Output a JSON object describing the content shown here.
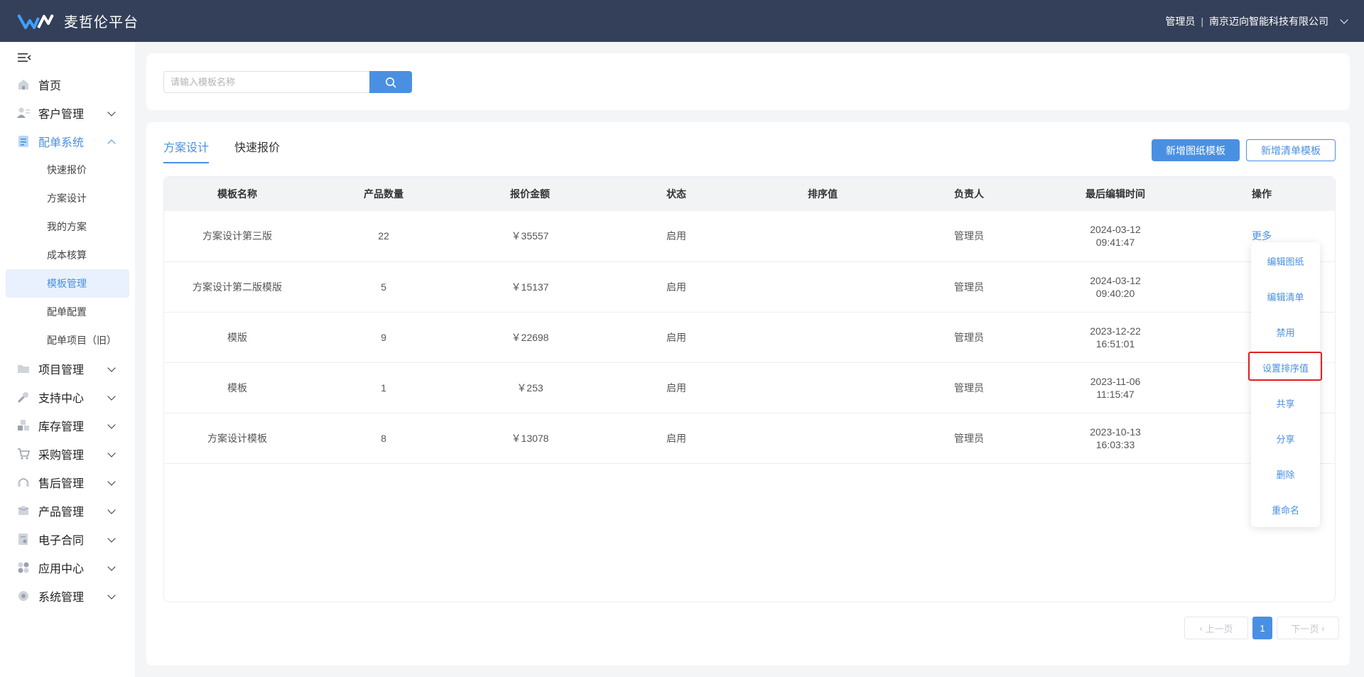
{
  "app": {
    "title": "麦哲伦平台"
  },
  "header": {
    "role": "管理员",
    "separator": "|",
    "company": "南京迈向智能科技有限公司"
  },
  "sidebar": {
    "items": [
      {
        "label": "首页",
        "icon": "home-icon"
      },
      {
        "label": "客户管理",
        "icon": "customer-icon"
      },
      {
        "label": "配单系统",
        "icon": "order-icon",
        "children": [
          "快速报价",
          "方案设计",
          "我的方案",
          "成本核算",
          "模板管理",
          "配单配置",
          "配单项目（旧）"
        ]
      },
      {
        "label": "项目管理",
        "icon": "folder-icon"
      },
      {
        "label": "支持中心",
        "icon": "wrench-icon"
      },
      {
        "label": "库存管理",
        "icon": "inventory-icon"
      },
      {
        "label": "采购管理",
        "icon": "cart-icon"
      },
      {
        "label": "售后管理",
        "icon": "headset-icon"
      },
      {
        "label": "产品管理",
        "icon": "box-icon"
      },
      {
        "label": "电子合同",
        "icon": "contract-icon"
      },
      {
        "label": "应用中心",
        "icon": "apps-icon"
      },
      {
        "label": "系统管理",
        "icon": "settings-icon"
      }
    ]
  },
  "search": {
    "placeholder": "请输入模板名称"
  },
  "tabs": [
    "方案设计",
    "快速报价"
  ],
  "actions": {
    "add_drawing_template": "新增图纸模板",
    "add_list_template": "新增清单模板"
  },
  "table": {
    "headers": [
      "模板名称",
      "产品数量",
      "报价金额",
      "状态",
      "排序值",
      "负责人",
      "最后编辑时间",
      "操作"
    ],
    "rows": [
      {
        "name": "方案设计第三版",
        "qty": "22",
        "amount": "￥35557",
        "status": "启用",
        "sort": "",
        "owner": "管理员",
        "date": "2024-03-12",
        "time": "09:41:47",
        "action": "更多"
      },
      {
        "name": "方案设计第二版模版",
        "qty": "5",
        "amount": "￥15137",
        "status": "启用",
        "sort": "",
        "owner": "管理员",
        "date": "2024-03-12",
        "time": "09:40:20",
        "action": ""
      },
      {
        "name": "模版",
        "qty": "9",
        "amount": "￥22698",
        "status": "启用",
        "sort": "",
        "owner": "管理员",
        "date": "2023-12-22",
        "time": "16:51:01",
        "action": ""
      },
      {
        "name": "模板",
        "qty": "1",
        "amount": "￥253",
        "status": "启用",
        "sort": "",
        "owner": "管理员",
        "date": "2023-11-06",
        "time": "11:15:47",
        "action": ""
      },
      {
        "name": "方案设计模板",
        "qty": "8",
        "amount": "￥13078",
        "status": "启用",
        "sort": "",
        "owner": "管理员",
        "date": "2023-10-13",
        "time": "16:03:33",
        "action": ""
      }
    ]
  },
  "dropdown": {
    "items": [
      "编辑图纸",
      "编辑清单",
      "禁用",
      "设置排序值",
      "共享",
      "分享",
      "删除",
      "重命名"
    ]
  },
  "pagination": {
    "prev": "上一页",
    "current": "1",
    "next": "下一页"
  },
  "colors": {
    "header_bg": "#34405a",
    "accent": "#4a90e2",
    "highlight": "#e02020"
  }
}
